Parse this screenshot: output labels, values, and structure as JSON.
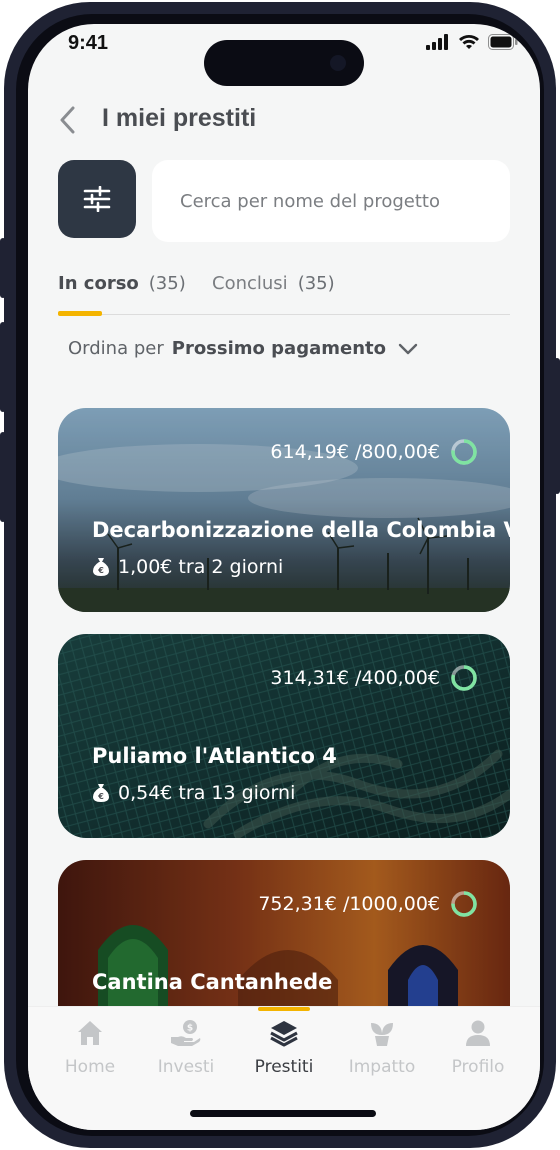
{
  "status_bar": {
    "time": "9:41"
  },
  "header": {
    "title": "I miei prestiti"
  },
  "search": {
    "placeholder": "Cerca per nome del progetto"
  },
  "tabs": [
    {
      "label": "In corso",
      "count": "(35)",
      "active": true
    },
    {
      "label": "Conclusi",
      "count": "(35)",
      "active": false
    }
  ],
  "sort": {
    "label": "Ordina per",
    "value": "Prossimo pagamento"
  },
  "loans": [
    {
      "title": "Decarbonizzazione della Colombia V",
      "amount": "614,19€ /800,00€",
      "payment": "1,00€ tra 2 giorni",
      "progress": 0.77
    },
    {
      "title": "Puliamo l'Atlantico 4",
      "amount": "314,31€ /400,00€",
      "payment": "0,54€ tra 13 giorni",
      "progress": 0.79
    },
    {
      "title": "Cantina Cantanhede",
      "amount": "752,31€ /1000,00€",
      "payment": "",
      "progress": 0.75
    }
  ],
  "bottom_nav": [
    {
      "label": "Home",
      "icon": "home-icon"
    },
    {
      "label": "Investi",
      "icon": "invest-hand-icon"
    },
    {
      "label": "Prestiti",
      "icon": "layers-icon",
      "active": true
    },
    {
      "label": "Impatto",
      "icon": "plant-icon"
    },
    {
      "label": "Profilo",
      "icon": "person-icon"
    }
  ],
  "colors": {
    "accent": "#f4b400",
    "filter_button": "#2e3744",
    "progress_ring": "#7fe3a1"
  }
}
